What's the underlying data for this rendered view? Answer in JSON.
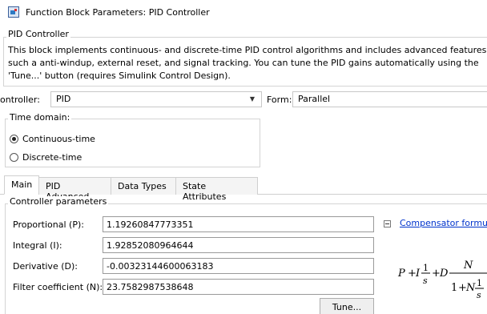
{
  "window": {
    "title": "Function Block Parameters: PID Controller",
    "icon": "simulink-block-icon"
  },
  "header_group": {
    "label": "PID Controller",
    "description": "This block implements continuous- and discrete-time PID control algorithms and includes advanced features such a anti-windup, external reset, and signal tracking. You can tune the PID gains automatically using the 'Tune...' button (requires Simulink Control Design)."
  },
  "controller": {
    "label": "ontroller:",
    "value": "PID",
    "form_label": "Form:",
    "form_value": "Parallel"
  },
  "time_domain": {
    "label": "Time domain:",
    "options": [
      {
        "label": "Continuous-time",
        "selected": true
      },
      {
        "label": "Discrete-time",
        "selected": false
      }
    ]
  },
  "tabs": [
    {
      "label": "Main",
      "active": true
    },
    {
      "label": "PID Advanced",
      "active": false
    },
    {
      "label": "Data Types",
      "active": false
    },
    {
      "label": "State Attributes",
      "active": false
    }
  ],
  "controller_parameters": {
    "label": "Controller parameters",
    "fields": [
      {
        "label": "Proportional (P):",
        "value": "1.19260847773351"
      },
      {
        "label": "Integral (I):",
        "value": "1.92852080964644"
      },
      {
        "label": "Derivative (D):",
        "value": "-0.00323144600063183"
      },
      {
        "label": "Filter coefficient (N):",
        "value": "23.7582987538648"
      }
    ],
    "tune_label": "Tune...",
    "compensator_link": "Compensator formul"
  }
}
